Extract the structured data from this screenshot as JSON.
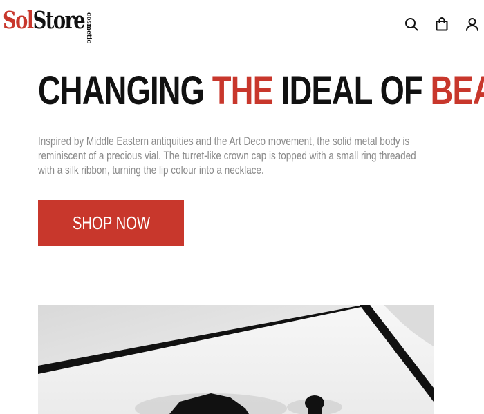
{
  "header": {
    "logo": {
      "part1": "Sol",
      "part2": "Store",
      "sub": "cosmetic"
    },
    "icons": [
      "search-icon",
      "bag-icon",
      "user-icon"
    ]
  },
  "hero": {
    "headline": {
      "part1": "CHANGING ",
      "part2": "THE",
      "part3": " IDEAL OF ",
      "part4": "BEAUTY"
    },
    "description": "Inspired by Middle Eastern antiquities and the Art Deco movement, the solid metal body is reminiscent of a precious vial. The turret-like crown cap is topped with a small ring threaded with a silk ribbon, turning the lip colour into a necklace.",
    "cta_label": "SHOP NOW"
  },
  "colors": {
    "accent": "#c8372c",
    "text_dark": "#111111",
    "text_muted": "#8a8a8a"
  }
}
